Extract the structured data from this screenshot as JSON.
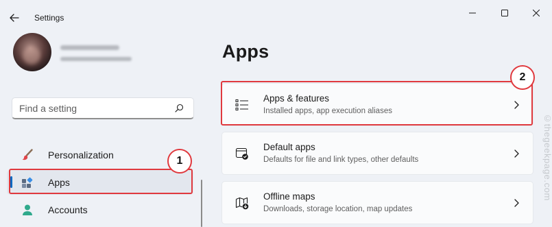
{
  "window": {
    "title": "Settings"
  },
  "profile": {
    "name": "",
    "email": ""
  },
  "search": {
    "placeholder": "Find a setting"
  },
  "sidebar": {
    "items": [
      {
        "label": "Personalization",
        "icon": "paintbrush-icon"
      },
      {
        "label": "Apps",
        "icon": "apps-icon",
        "active": true
      },
      {
        "label": "Accounts",
        "icon": "person-icon"
      }
    ]
  },
  "main": {
    "title": "Apps",
    "cards": [
      {
        "title": "Apps & features",
        "subtitle": "Installed apps, app execution aliases",
        "icon": "list-icon"
      },
      {
        "title": "Default apps",
        "subtitle": "Defaults for file and link types, other defaults",
        "icon": "default-apps-icon"
      },
      {
        "title": "Offline maps",
        "subtitle": "Downloads, storage location, map updates",
        "icon": "map-download-icon"
      }
    ]
  },
  "annotations": {
    "badge1": "1",
    "badge2": "2"
  },
  "watermark": "©thegeekpage.com",
  "colors": {
    "accent": "#0067c0",
    "annotation_red": "#e0393e",
    "background": "#eef1f6",
    "card": "#fafbfc"
  }
}
